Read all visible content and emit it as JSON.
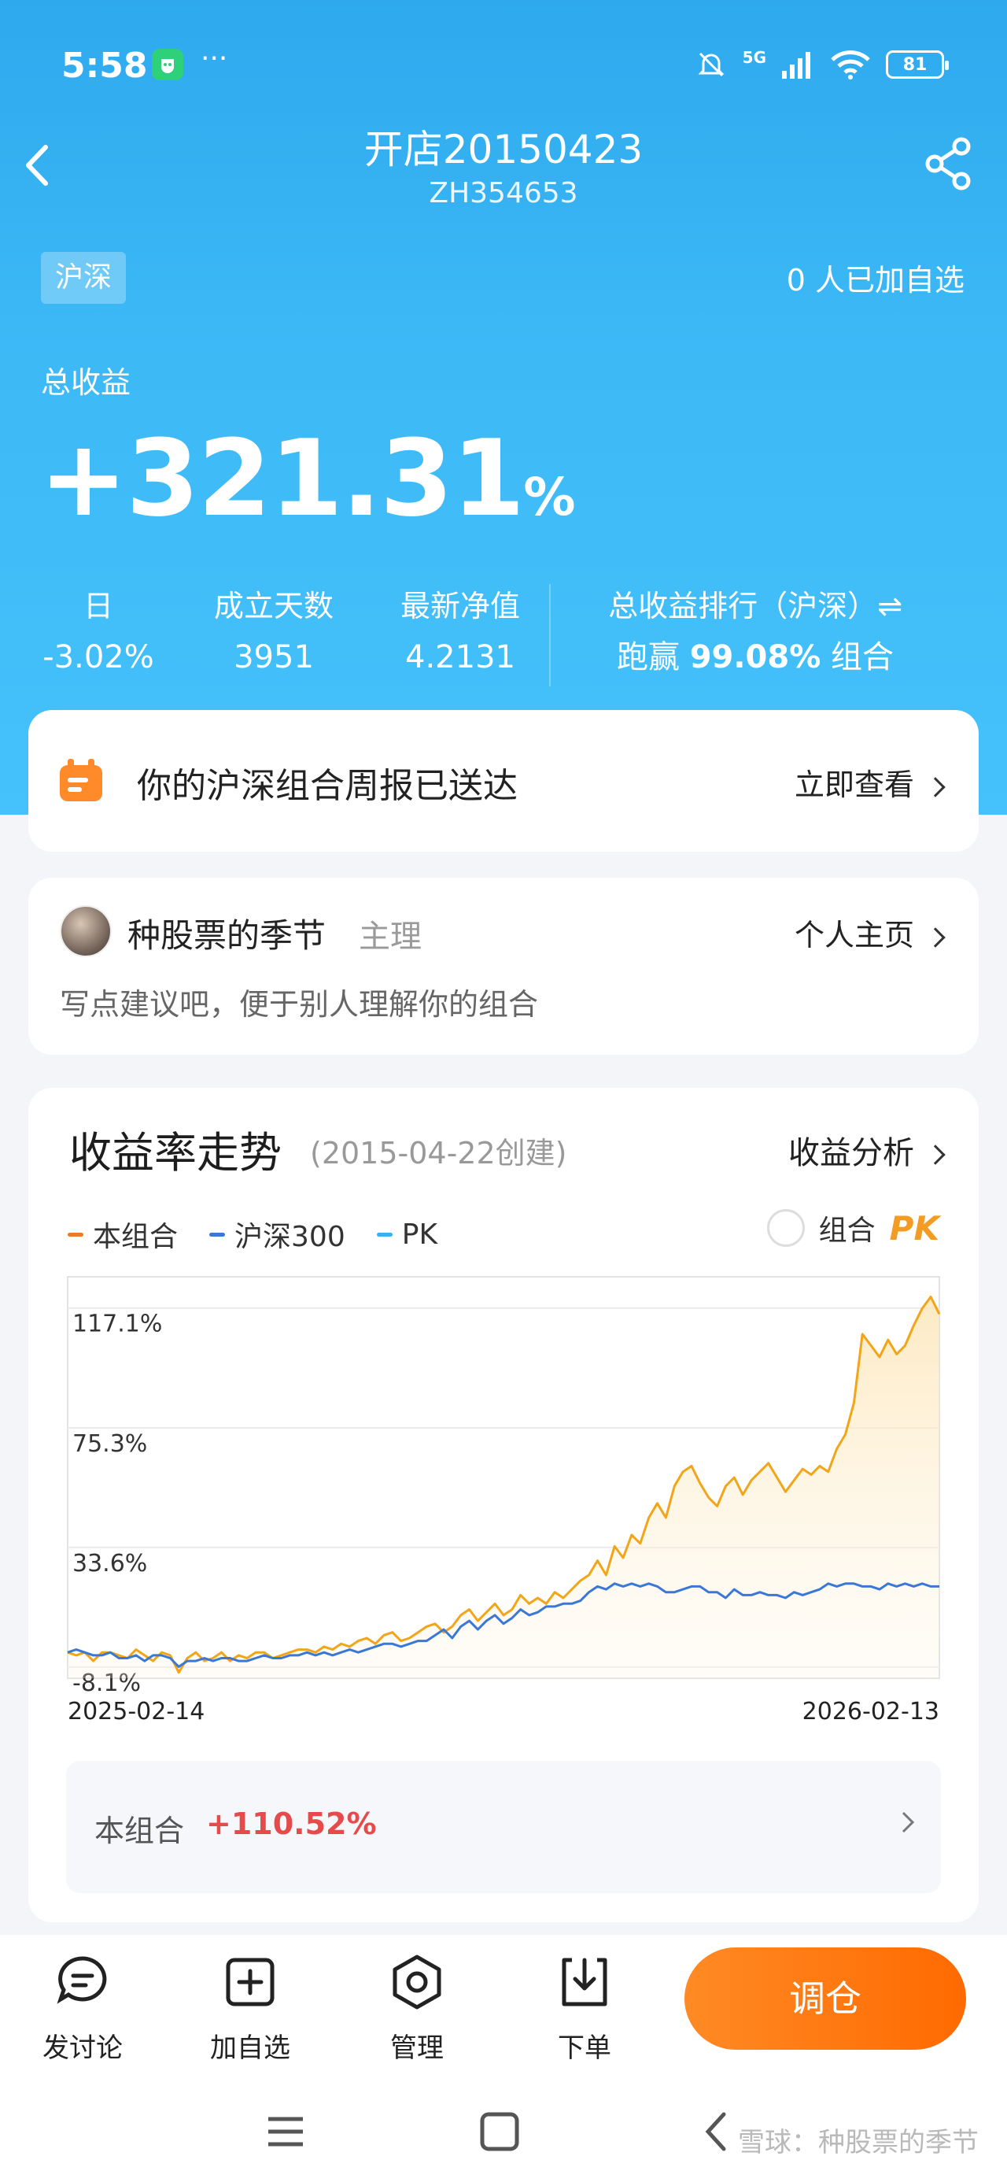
{
  "status_bar": {
    "time": "5:58",
    "dots": "···",
    "network": "5G",
    "battery": "81"
  },
  "header": {
    "title": "开店20150423",
    "code": "ZH354653"
  },
  "market_tag": "沪深",
  "followers_text": "0 人已加自选",
  "summary": {
    "total_label": "总收益",
    "total_value": "+321.31",
    "total_unit": "%",
    "stats": [
      {
        "label": "日",
        "value": "-3.02%"
      },
      {
        "label": "成立天数",
        "value": "3951"
      },
      {
        "label": "最新净值",
        "value": "4.2131"
      }
    ],
    "rank_label": "总收益排行（沪深）⇌",
    "rank_prefix": "跑赢",
    "rank_value": "99.08%",
    "rank_suffix": "组合"
  },
  "report": {
    "text": "你的沪深组合周报已送达",
    "link": "立即查看"
  },
  "owner": {
    "name": "种股票的季节",
    "role": "主理",
    "link": "个人主页",
    "description": "写点建议吧，便于别人理解你的组合"
  },
  "chart_section": {
    "title": "收益率走势",
    "created": "(2015-04-22创建)",
    "link": "收益分析",
    "legend": [
      {
        "label": "本组合",
        "color": "#f07a24"
      },
      {
        "label": "沪深300",
        "color": "#3a78d8"
      },
      {
        "label": "PK",
        "color": "#36b3ea"
      }
    ],
    "pk_label": "组合",
    "pk_badge": "PK",
    "summary_label": "本组合",
    "summary_value": "+110.52%"
  },
  "chart_data": {
    "type": "line",
    "x_start": "2025-02-14",
    "x_end": "2026-02-13",
    "y_ticks": [
      {
        "value": 117.1,
        "label": "117.1%"
      },
      {
        "value": 75.3,
        "label": "75.3%"
      },
      {
        "value": 33.6,
        "label": "33.6%"
      },
      {
        "value": -8.1,
        "label": "-8.1%"
      }
    ],
    "ylim": [
      -12,
      128
    ],
    "colors": {
      "portfolio": "#f3a519",
      "index": "#3a78d8"
    },
    "series": [
      {
        "name": "本组合",
        "values": [
          -3,
          -4,
          -3,
          -6,
          -3,
          -3,
          -4,
          -5,
          -2,
          -4,
          -6,
          -3,
          -4,
          -10,
          -5,
          -3,
          -6,
          -5,
          -3,
          -6,
          -4,
          -5,
          -3,
          -3,
          -5,
          -4,
          -3,
          -2,
          -2,
          -3,
          -1,
          -2,
          0,
          -1,
          1,
          2,
          0,
          3,
          4,
          1,
          2,
          4,
          6,
          7,
          4,
          6,
          10,
          12,
          8,
          11,
          14,
          10,
          12,
          17,
          14,
          16,
          14,
          18,
          16,
          19,
          22,
          24,
          29,
          24,
          34,
          30,
          38,
          35,
          44,
          49,
          44,
          55,
          60,
          62,
          56,
          51,
          48,
          55,
          58,
          52,
          57,
          60,
          63,
          58,
          53,
          57,
          61,
          59,
          62,
          60,
          68,
          73,
          84,
          108,
          104,
          100,
          106,
          101,
          104,
          111,
          117,
          121,
          115
        ]
      },
      {
        "name": "沪深300",
        "values": [
          -3,
          -2,
          -3,
          -4,
          -4,
          -3,
          -5,
          -5,
          -4,
          -6,
          -4,
          -4,
          -5,
          -8,
          -6,
          -6,
          -5,
          -6,
          -5,
          -5,
          -6,
          -6,
          -5,
          -4,
          -5,
          -5,
          -4,
          -4,
          -3,
          -4,
          -3,
          -4,
          -3,
          -2,
          -3,
          -2,
          -1,
          0,
          0,
          -1,
          0,
          1,
          1,
          3,
          5,
          2,
          6,
          8,
          5,
          8,
          10,
          7,
          9,
          12,
          10,
          11,
          13,
          13,
          14,
          14,
          15,
          18,
          20,
          19,
          21,
          20,
          21,
          20,
          21,
          20,
          18,
          18,
          19,
          20,
          20,
          18,
          18,
          16,
          19,
          17,
          17,
          18,
          17,
          17,
          16,
          18,
          17,
          18,
          19,
          21,
          20,
          21,
          21,
          20,
          20,
          19,
          21,
          20,
          21,
          20,
          21,
          20,
          20
        ]
      }
    ]
  },
  "toolbar": [
    {
      "label": "发讨论",
      "icon": "comment-icon"
    },
    {
      "label": "加自选",
      "icon": "add-square-icon"
    },
    {
      "label": "管理",
      "icon": "hexagon-settings-icon"
    },
    {
      "label": "下单",
      "icon": "download-tray-icon"
    }
  ],
  "rebalance_label": "调仓",
  "watermark": "雪球：种股票的季节"
}
